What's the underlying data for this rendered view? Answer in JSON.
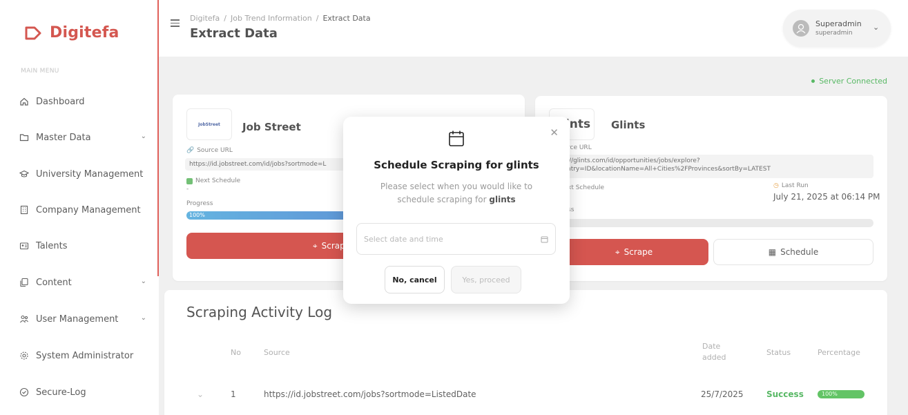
{
  "sidebar": {
    "brand": "Digitefa",
    "caption": "MAIN MENU",
    "items": [
      {
        "label": "Dashboard",
        "icon": "home-icon"
      },
      {
        "label": "Master Data",
        "icon": "folder-icon",
        "has_submenu": true
      },
      {
        "label": "University Management",
        "icon": "graduation-cap-icon"
      },
      {
        "label": "Company Management",
        "icon": "building-icon"
      },
      {
        "label": "Talents",
        "icon": "id-card-icon"
      },
      {
        "label": "Content",
        "icon": "copy-icon",
        "has_submenu": true
      },
      {
        "label": "User Management",
        "icon": "users-icon",
        "has_submenu": true
      },
      {
        "label": "System Administrator",
        "icon": "gear-icon"
      },
      {
        "label": "Secure-Log",
        "icon": "shield-check-icon"
      }
    ]
  },
  "header": {
    "breadcrumbs": [
      "Digitefa",
      "/",
      "Job Trend Information",
      "/",
      "Extract Data"
    ],
    "title": "Extract Data",
    "user": {
      "name": "Superadmin",
      "role": "superadmin"
    }
  },
  "status": {
    "server": "Server Connected",
    "color": "#2aa53a"
  },
  "cards": [
    {
      "name": "Job Street",
      "logo_text": "JobStreet",
      "source_label": "Source URL",
      "url": "https://id.jobstreet.com/id/jobs?sortmode=L",
      "next_schedule_label": "Next Schedule",
      "next_schedule": "-",
      "progress_label": "Progress",
      "progress": "100%",
      "scrape_label": "Scrape"
    },
    {
      "name": "Glints",
      "logo_text": "glints",
      "source_label": "rce URL",
      "url_line1": "://glints.com/id/opportunities/jobs/explore?",
      "url_line2": "ntry=ID&locationName=All+Cities%2FProvinces&sortBy=LATEST",
      "next_schedule_label": "xt Schedule",
      "last_run_label": "Last Run",
      "last_run": "July 21, 2025 at 06:14 PM",
      "progress_label": "ss",
      "scrape_label": "Scrape",
      "schedule_label": "Schedule"
    }
  ],
  "log": {
    "title": "Scraping Activity Log",
    "columns": [
      "No",
      "Source",
      "Date added",
      "Status",
      "Percentage"
    ],
    "rows": [
      {
        "no": "1",
        "source": "https://id.jobstreet.com/jobs?sortmode=ListedDate",
        "date": "25/7/2025",
        "status": "Success",
        "percentage": "100%"
      }
    ]
  },
  "modal": {
    "title": "Schedule Scraping for glints",
    "desc_prefix": "Please select when you would like to schedule scraping for",
    "desc_target": "glints",
    "date_placeholder": "Select date and time",
    "cancel_label": "No, cancel",
    "proceed_label": "Yes, proceed"
  },
  "colors": {
    "brand": "#c8281f",
    "primary_button": "#c9271f",
    "success": "#2aa53a"
  }
}
